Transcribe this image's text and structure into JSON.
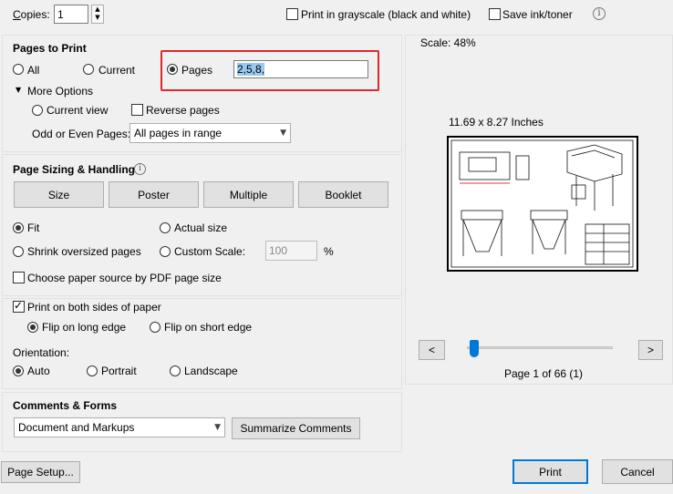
{
  "top": {
    "copies_label": "Copies:",
    "copies_value": "1",
    "grayscale_label": "Print in grayscale (black and white)",
    "save_ink_label": "Save ink/toner",
    "info_icon": "info-icon"
  },
  "pages_to_print": {
    "title": "Pages to Print",
    "all_label": "All",
    "current_label": "Current",
    "pages_label": "Pages",
    "pages_value": "2,5,8,",
    "more_options_label": "More Options",
    "current_view_label": "Current view",
    "reverse_pages_label": "Reverse pages",
    "odd_even_label": "Odd or Even Pages:",
    "odd_even_value": "All pages in range"
  },
  "sizing": {
    "title": "Page Sizing & Handling",
    "size_btn": "Size",
    "poster_btn": "Poster",
    "multiple_btn": "Multiple",
    "booklet_btn": "Booklet",
    "fit_label": "Fit",
    "actual_size_label": "Actual size",
    "shrink_label": "Shrink oversized pages",
    "custom_scale_label": "Custom Scale:",
    "custom_scale_value": "100",
    "percent": "%",
    "paper_source_label": "Choose paper source by PDF page size"
  },
  "duplex": {
    "both_sides_label": "Print on both sides of paper",
    "long_edge_label": "Flip on long edge",
    "short_edge_label": "Flip on short edge",
    "orientation_label": "Orientation:",
    "auto_label": "Auto",
    "portrait_label": "Portrait",
    "landscape_label": "Landscape"
  },
  "comments": {
    "title": "Comments & Forms",
    "select_value": "Document and Markups",
    "summarize_btn": "Summarize Comments"
  },
  "preview": {
    "scale_text": "Scale:  48%",
    "dimensions": "11.69 x 8.27 Inches",
    "prev_btn": "<",
    "next_btn": ">",
    "page_info": "Page 1 of 66 (1)"
  },
  "footer": {
    "page_setup_btn": "Page Setup...",
    "print_btn": "Print",
    "cancel_btn": "Cancel"
  },
  "colors": {
    "highlight": "#e0262b",
    "slider_accent": "#0078d7"
  }
}
